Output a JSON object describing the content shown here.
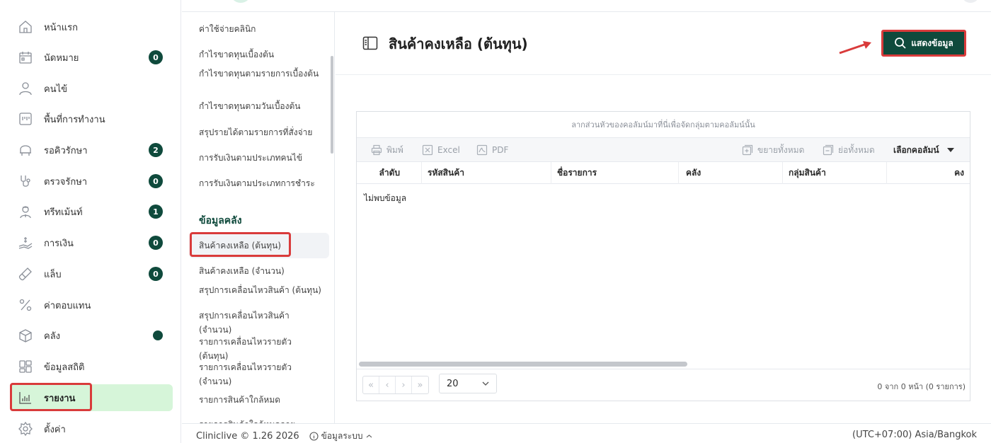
{
  "sidebar": {
    "items": [
      {
        "label": "หน้าแรก",
        "icon": "home-icon",
        "badge": ""
      },
      {
        "label": "นัดหมาย",
        "icon": "calendar-icon",
        "badge": "0"
      },
      {
        "label": "คนไข้",
        "icon": "user-icon",
        "badge": ""
      },
      {
        "label": "พื้นที่การทำงาน",
        "icon": "workspace-icon",
        "badge": ""
      },
      {
        "label": "รอคิวรักษา",
        "icon": "dental-chair-icon",
        "badge": "2"
      },
      {
        "label": "ตรวจรักษา",
        "icon": "stethoscope-icon",
        "badge": "0"
      },
      {
        "label": "ทรีทเม้นท์",
        "icon": "doctor-icon",
        "badge": "1"
      },
      {
        "label": "การเงิน",
        "icon": "money-hand-icon",
        "badge": "0"
      },
      {
        "label": "แล็บ",
        "icon": "test-tube-icon",
        "badge": "0"
      },
      {
        "label": "ค่าตอบแทน",
        "icon": "percent-icon",
        "badge": ""
      },
      {
        "label": "คลัง",
        "icon": "box-icon",
        "badge": ""
      },
      {
        "label": "ข้อมูลสถิติ",
        "icon": "dashboard-icon",
        "badge": ""
      },
      {
        "label": "รายงาน",
        "icon": "report-chart-icon",
        "badge": ""
      },
      {
        "label": "ตั้งค่า",
        "icon": "gear-icon",
        "badge": ""
      }
    ]
  },
  "submenu": {
    "finance_items": [
      "ค่าใช้จ่ายคลินิก",
      "กำไรขาดทุนเบื้องต้น",
      "กำไรขาดทุนตามรายการเบื้องต้น",
      "กำไรขาดทุนตามวันเบื้องต้น",
      "สรุปรายได้ตามรายการที่สั่งจ่าย",
      "การรับเงินตามประเภทคนไข้",
      "การรับเงินตามประเภทการชำระ"
    ],
    "heading": "ข้อมูลคลัง",
    "inventory_items": [
      "สินค้าคงเหลือ (ต้นทุน)",
      "สินค้าคงเหลือ (จำนวน)",
      "สรุปการเคลื่อนไหวสินค้า (ต้นทุน)",
      "สรุปการเคลื่อนไหวสินค้า (จำนวน)",
      "รายการเคลื่อนไหวรายตัว (ต้นทุน)",
      "รายการเคลื่อนไหวรายตัว (จำนวน)",
      "รายการสินค้าใกล้หมด",
      "รายการสินค้าใกล้หมดอายุ"
    ]
  },
  "main": {
    "title": "สินค้าคงเหลือ (ต้นทุน)",
    "show_button": "แสดงข้อมูล"
  },
  "grid": {
    "group_panel": "ลากส่วนหัวของคอลัมน์มาที่นี่เพื่อจัดกลุ่มตามคอลัมน์นั้น",
    "toolbar": {
      "print": "พิมพ์",
      "excel": "Excel",
      "pdf": "PDF",
      "expand_all": "ขยายทั้งหมด",
      "collapse_all": "ย่อทั้งหมด",
      "choose_columns": "เลือกคอลัมน์"
    },
    "columns": [
      "ลำดับ",
      "รหัสสินค้า",
      "ชื่อรายการ",
      "คลัง",
      "กลุ่มสินค้า",
      "คง"
    ],
    "no_data": "ไม่พบข้อมูล",
    "pager": {
      "first": "«",
      "prev": "‹",
      "next": "›",
      "last": "»",
      "page_size": "20",
      "info": "0 จาก 0 หน้า (0 รายการ)"
    }
  },
  "footer": {
    "version": "Cliniclive © 1.26 2026",
    "system_info": "ข้อมูลระบบ",
    "timezone": "(UTC+07:00) Asia/Bangkok"
  },
  "colors": {
    "brand": "#0f4a3c",
    "active_bg": "#d6f5d9",
    "highlight": "#d93b3b"
  }
}
